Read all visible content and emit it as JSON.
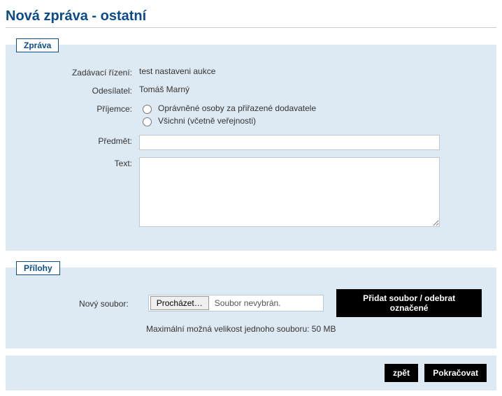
{
  "page_title": "Nová zpráva - ostatní",
  "message_panel": {
    "legend": "Zpráva",
    "proceeding_label": "Zadávací řízení:",
    "proceeding_value": "test nastaveni aukce",
    "sender_label": "Odesílatel:",
    "sender_value": "Tomáš Marný",
    "recipient_label": "Příjemce:",
    "recipient_option1": "Oprávněné osoby za přiřazené dodavatele",
    "recipient_option2": "Všichni (včetně veřejnosti)",
    "subject_label": "Předmět:",
    "subject_value": "",
    "text_label": "Text:",
    "text_value": ""
  },
  "attachments_panel": {
    "legend": "Přílohy",
    "new_file_label": "Nový soubor:",
    "browse_button": "Procházet…",
    "file_status": "Soubor nevybrán.",
    "add_button": "Přidat soubor / odebrat označené",
    "size_hint": "Maximální možná velikost jednoho souboru: 50 MB"
  },
  "actions": {
    "back": "zpět",
    "continue": "Pokračovat"
  }
}
